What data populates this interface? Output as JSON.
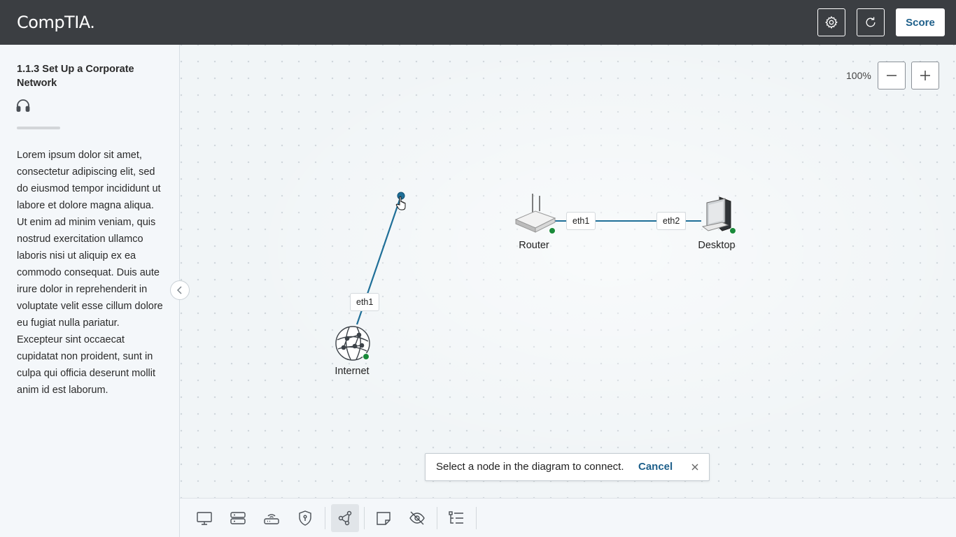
{
  "header": {
    "logo_text": "CompTIA.",
    "settings_icon": "gear-icon",
    "reset_icon": "refresh-icon",
    "score_label": "Score"
  },
  "sidebar": {
    "title": "1.1.3 Set Up a Corporate Network",
    "audio_icon": "headphones-icon",
    "progress": 0,
    "body": "Lorem ipsum dolor sit amet, consectetur adipiscing elit, sed do eiusmod tempor incididunt ut labore et dolore magna aliqua. Ut enim ad minim veniam, quis nostrud exercitation ullamco laboris nisi ut aliquip ex ea commodo consequat. Duis aute irure dolor in reprehenderit in voluptate velit esse cillum dolore eu fugiat nulla pariatur. Excepteur sint occaecat cupidatat non proident, sunt in culpa qui officia deserunt mollit anim id est laborum."
  },
  "canvas": {
    "zoom": "100%",
    "nodes": {
      "internet": {
        "label": "Internet",
        "port": "eth1"
      },
      "router": {
        "label": "Router",
        "port": "eth1"
      },
      "desktop": {
        "label": "Desktop",
        "port": "eth2"
      }
    }
  },
  "toast": {
    "message": "Select a node in the diagram to connect.",
    "cancel_label": "Cancel"
  },
  "colors": {
    "header_bg": "#3b3e42",
    "accent": "#1d5f8a",
    "link": "#1f6f98",
    "status_ok": "#1a8a3a"
  },
  "toolbar": {
    "tools": [
      "desktop-icon",
      "server-icon",
      "router-icon",
      "shield-icon",
      "connect-icon",
      "note-icon",
      "hide-icon",
      "list-icon"
    ],
    "active": "connect-icon"
  }
}
